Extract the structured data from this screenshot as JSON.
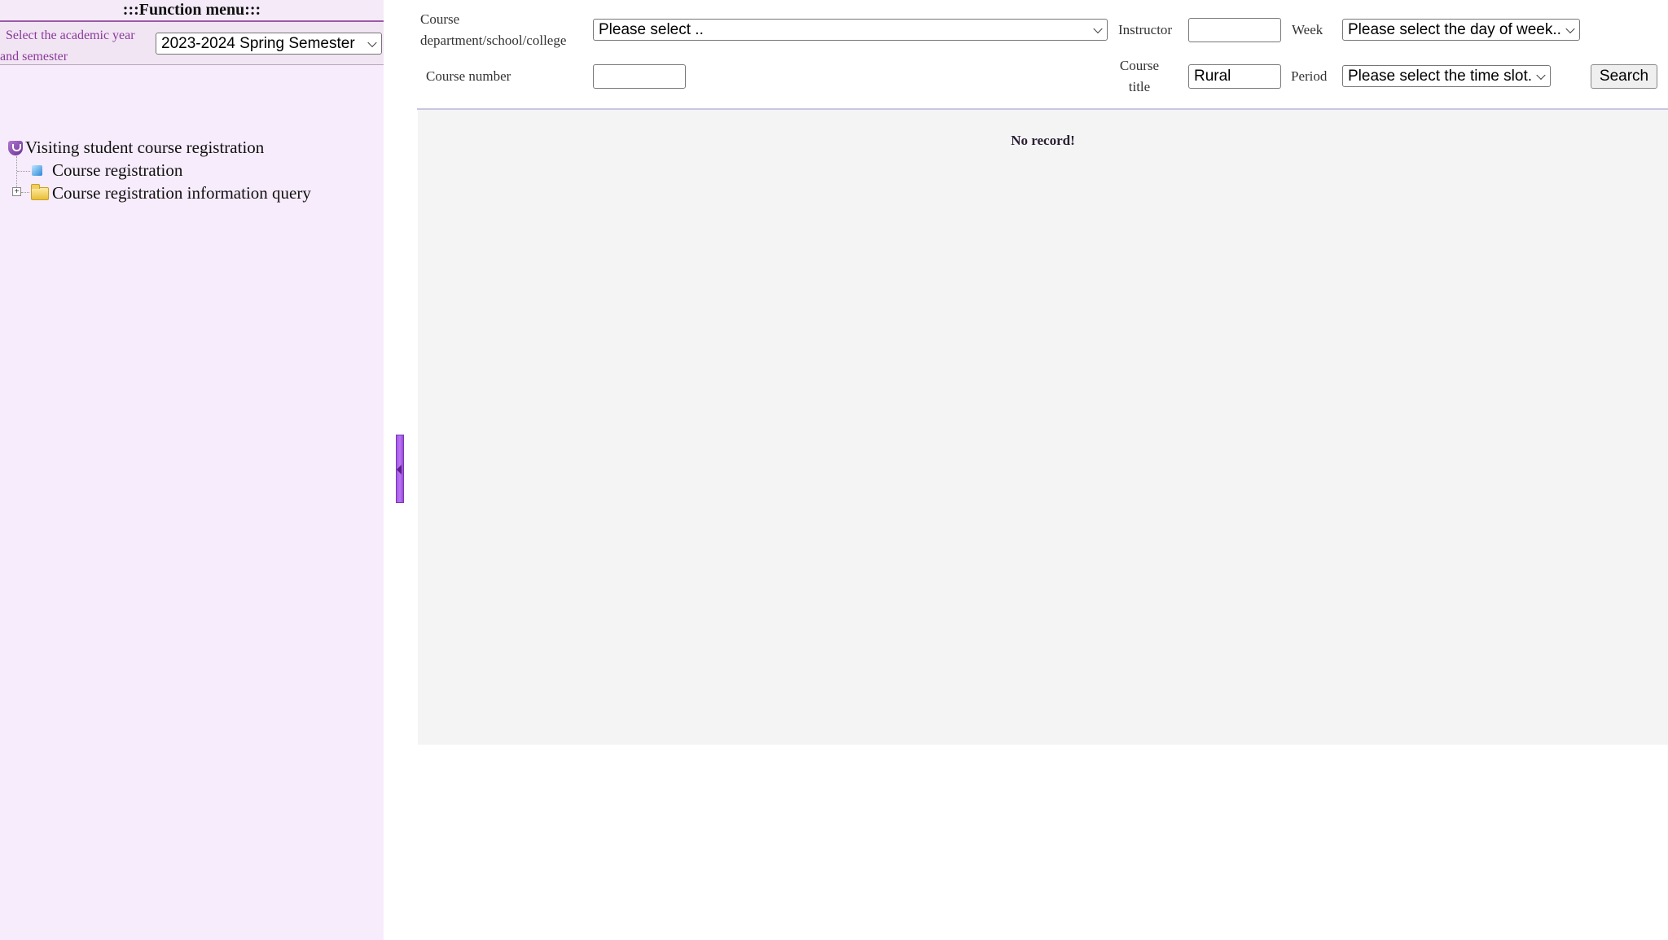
{
  "sidebar": {
    "title": ":::Function menu:::",
    "year_label": "Select the academic year and semester",
    "year_select": "2023-2024 Spring Semester",
    "tree": {
      "root": "Visiting student course registration",
      "children": [
        {
          "label": "Course registration",
          "icon": "cube-icon"
        },
        {
          "label": "Course registration information query",
          "icon": "folder-icon",
          "expandable": true
        }
      ]
    }
  },
  "filters": {
    "department_label": "Course department/school/college",
    "department_select": "Please select ..",
    "instructor_label": "Instructor",
    "instructor_value": "",
    "week_label": "Week",
    "week_select": "Please select the day of week..",
    "course_number_label": "Course number",
    "course_number_value": "",
    "course_title_label": "Course title",
    "course_title_value": "Rural",
    "period_label": "Period",
    "period_select": "Please select the time slot.",
    "search_button": "Search"
  },
  "results": {
    "message": "No record!"
  },
  "colors": {
    "sidebar_bg": "#f7ecfb",
    "accent_purple": "#9a5aa8",
    "splitter": "#a659e8"
  }
}
